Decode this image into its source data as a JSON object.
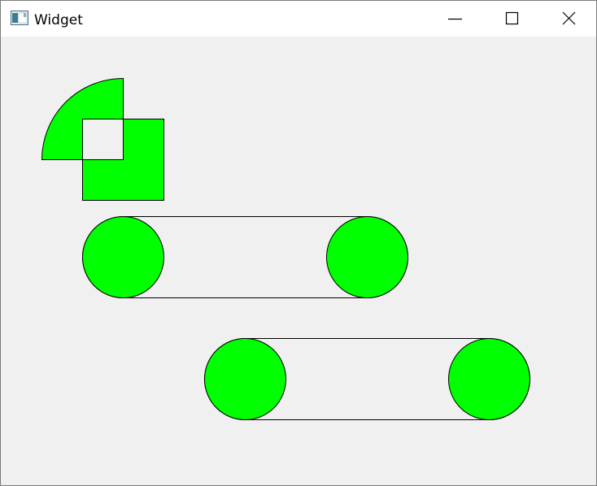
{
  "window": {
    "title": "Widget",
    "icon": "app-window-icon",
    "controls": [
      {
        "name": "minimize-icon"
      },
      {
        "name": "maximize-icon"
      },
      {
        "name": "close-icon"
      }
    ]
  },
  "colors": {
    "shape_fill": "#00ff00",
    "stroke": "#000000",
    "client_background": "#f0f0f0",
    "titlebar_background": "#ffffff"
  },
  "canvas": {
    "shapes": [
      "quarter-pie",
      "square",
      "capsule-with-circles",
      "capsule-with-circles"
    ]
  }
}
